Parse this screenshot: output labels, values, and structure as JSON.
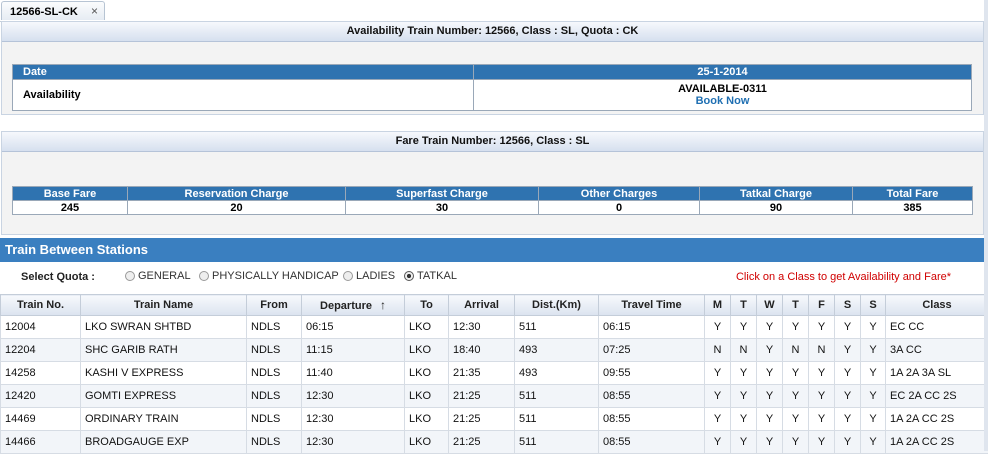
{
  "tab": {
    "label": "12566-SL-CK",
    "close": "×"
  },
  "availability": {
    "title": "Availability Train Number: 12566, Class : SL, Quota : CK",
    "date_label": "Date",
    "date_value": "25-1-2014",
    "availability_label": "Availability",
    "status": "AVAILABLE-0311",
    "book_now": "Book Now"
  },
  "fare": {
    "title": "Fare Train Number: 12566, Class : SL",
    "headers": [
      "Base Fare",
      "Reservation Charge",
      "Superfast Charge",
      "Other Charges",
      "Tatkal Charge",
      "Total Fare"
    ],
    "values": [
      "245",
      "20",
      "30",
      "0",
      "90",
      "385"
    ]
  },
  "tbs": {
    "title": "Train Between Stations",
    "quota_label": "Select Quota :",
    "quotas": [
      "GENERAL",
      "PHYSICALLY HANDICAP",
      "LADIES",
      "TATKAL"
    ],
    "selected_quota": "TATKAL",
    "hint": "Click on a Class to get Availability and Fare*",
    "columns": [
      "Train No.",
      "Train Name",
      "From",
      "Departure",
      "To",
      "Arrival",
      "Dist.(Km)",
      "Travel Time",
      "M",
      "T",
      "W",
      "T",
      "F",
      "S",
      "S",
      "Class"
    ],
    "sort_icon": "↑",
    "rows": [
      [
        "12004",
        "LKO SWRAN SHTBD",
        "NDLS",
        "06:15",
        "LKO",
        "12:30",
        "511",
        "06:15",
        "Y",
        "Y",
        "Y",
        "Y",
        "Y",
        "Y",
        "Y",
        "EC CC"
      ],
      [
        "12204",
        "SHC GARIB RATH",
        "NDLS",
        "11:15",
        "LKO",
        "18:40",
        "493",
        "07:25",
        "N",
        "N",
        "Y",
        "N",
        "N",
        "Y",
        "Y",
        "3A CC"
      ],
      [
        "14258",
        "KASHI V EXPRESS",
        "NDLS",
        "11:40",
        "LKO",
        "21:35",
        "493",
        "09:55",
        "Y",
        "Y",
        "Y",
        "Y",
        "Y",
        "Y",
        "Y",
        "1A 2A 3A SL"
      ],
      [
        "12420",
        "GOMTI EXPRESS",
        "NDLS",
        "12:30",
        "LKO",
        "21:25",
        "511",
        "08:55",
        "Y",
        "Y",
        "Y",
        "Y",
        "Y",
        "Y",
        "Y",
        "EC 2A CC 2S"
      ],
      [
        "14469",
        "ORDINARY TRAIN",
        "NDLS",
        "12:30",
        "LKO",
        "21:25",
        "511",
        "08:55",
        "Y",
        "Y",
        "Y",
        "Y",
        "Y",
        "Y",
        "Y",
        "1A 2A CC 2S"
      ],
      [
        "14466",
        "BROADGAUGE EXP",
        "NDLS",
        "12:30",
        "LKO",
        "21:25",
        "511",
        "08:55",
        "Y",
        "Y",
        "Y",
        "Y",
        "Y",
        "Y",
        "Y",
        "1A 2A CC 2S"
      ]
    ]
  },
  "colors": {
    "header_blue": "#2f73b0",
    "section_blue": "#3a7fc0",
    "link": "#1f6fb2",
    "hint_red": "#d00000"
  }
}
